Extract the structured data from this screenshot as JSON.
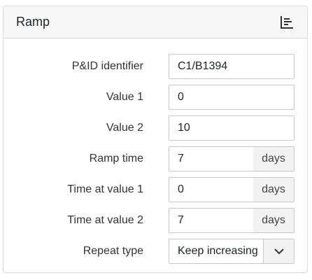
{
  "panel": {
    "title": "Ramp",
    "header_icon": "chart-icon"
  },
  "form": {
    "pid": {
      "label": "P&ID identifier",
      "value": "C1/B1394"
    },
    "value1": {
      "label": "Value 1",
      "value": "0"
    },
    "value2": {
      "label": "Value 2",
      "value": "10"
    },
    "ramp_time": {
      "label": "Ramp time",
      "value": "7",
      "unit": "days"
    },
    "time_value1": {
      "label": "Time at value 1",
      "value": "0",
      "unit": "days"
    },
    "time_value2": {
      "label": "Time at value 2",
      "value": "7",
      "unit": "days"
    },
    "repeat_type": {
      "label": "Repeat type",
      "value": "Keep increasing",
      "toggle_icon": "chevron-down-icon"
    }
  }
}
